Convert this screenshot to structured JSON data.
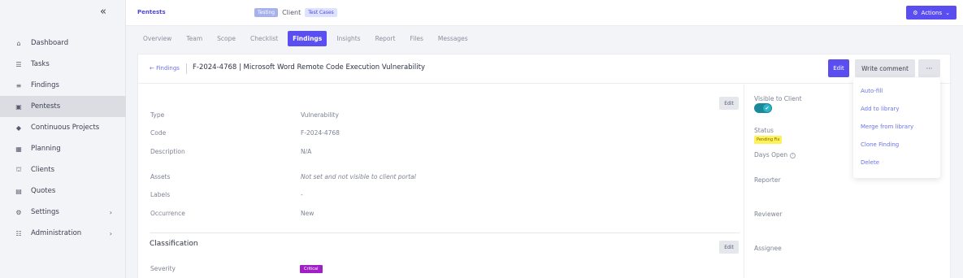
{
  "sidebar": {
    "collapse_glyph": "«",
    "items": [
      {
        "label": "Dashboard",
        "icon": "dashboard-icon",
        "glyph": "⌂"
      },
      {
        "label": "Tasks",
        "icon": "tasks-icon",
        "glyph": "☰"
      },
      {
        "label": "Findings",
        "icon": "findings-icon",
        "glyph": "≡"
      },
      {
        "label": "Pentests",
        "icon": "pentests-icon",
        "glyph": "▣"
      },
      {
        "label": "Continuous Projects",
        "icon": "shield-icon",
        "glyph": "◆"
      },
      {
        "label": "Planning",
        "icon": "calendar-icon",
        "glyph": "▦"
      },
      {
        "label": "Clients",
        "icon": "clients-icon",
        "glyph": "⛫"
      },
      {
        "label": "Quotes",
        "icon": "quotes-icon",
        "glyph": "▤"
      },
      {
        "label": "Settings",
        "icon": "gear-icon",
        "glyph": "⚙",
        "chevron": "›"
      },
      {
        "label": "Administration",
        "icon": "admin-icon",
        "glyph": "☷",
        "chevron": "›"
      }
    ]
  },
  "topbar": {
    "project": "Pentests",
    "status_badge": "Testing",
    "client_label": "Client",
    "client_badge": "Test Cases",
    "actions_label": "Actions",
    "actions_icon_glyph": "⚙",
    "actions_chevron": "⌄"
  },
  "tabs": [
    "Overview",
    "Team",
    "Scope",
    "Checklist",
    "Findings",
    "Insights",
    "Report",
    "Files",
    "Messages"
  ],
  "active_tab": "Findings",
  "header": {
    "back_link": "← Findings",
    "title": "F-2024-4768 | Microsoft Word Remote Code Execution Vulnerability",
    "edit": "Edit",
    "write_comment": "Write comment",
    "more": "···"
  },
  "fields": {
    "edit_label": "Edit",
    "type_label": "Type",
    "type_value": "Vulnerability",
    "code_label": "Code",
    "code_value": "F-2024-4768",
    "description_label": "Description",
    "description_value": "N/A",
    "assets_label": "Assets",
    "assets_value": "Not set and not visible to client portal",
    "labels_label": "Labels",
    "labels_value": "-",
    "occurrence_label": "Occurrence",
    "occurrence_value": "New"
  },
  "classification": {
    "title": "Classification",
    "edit_label": "Edit",
    "severity_label": "Severity",
    "severity_value": "Critical"
  },
  "right_panel": {
    "visible_label": "Visible to Client",
    "visible_on": true,
    "toggle_check": "✔",
    "status_label": "Status",
    "status_value": "Pending Fix",
    "days_open_label": "Days Open",
    "info_glyph": "i",
    "reporter_label": "Reporter",
    "reviewer_label": "Reviewer",
    "assignee_label": "Assignee"
  },
  "dropdown": {
    "items": [
      "Auto-fill",
      "Add to library",
      "Merge from library",
      "Clone Finding",
      "Delete"
    ]
  },
  "colors": {
    "accent": "#5b4ef0",
    "critical": "#a020c6",
    "pending": "#fff15a",
    "link": "#6a73e6"
  }
}
